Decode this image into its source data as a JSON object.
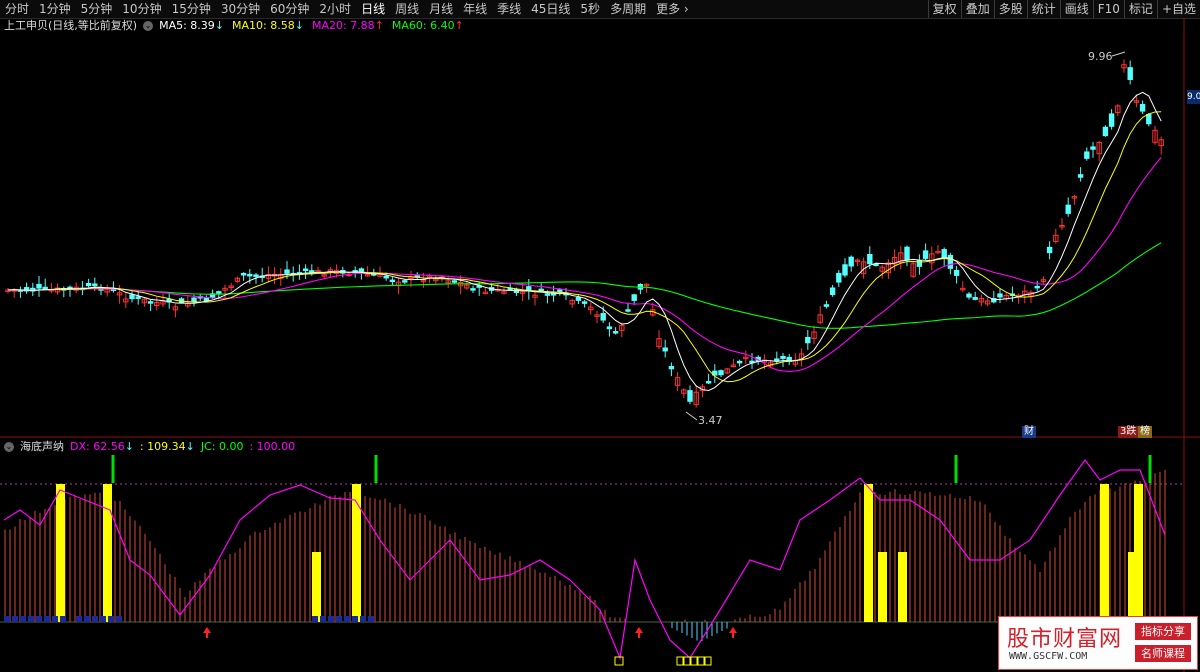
{
  "toolbar": {
    "periods": [
      "分时",
      "1分钟",
      "5分钟",
      "10分钟",
      "15分钟",
      "30分钟",
      "60分钟",
      "2小时",
      "日线",
      "周线",
      "月线",
      "年线",
      "季线",
      "45日线",
      "5秒",
      "多周期",
      "更多 ›"
    ],
    "active_period": "日线",
    "right_tools": [
      "复权",
      "叠加",
      "多股",
      "统计",
      "画线",
      "F10",
      "标记",
      "+自选"
    ]
  },
  "main_chart": {
    "stock_label": "上工申贝(日线,等比前复权)",
    "ma": [
      {
        "label": "MA5: 8.39",
        "arrow": "↓",
        "color": "#ffffff"
      },
      {
        "label": "MA10: 8.58",
        "arrow": "↓",
        "color": "#ffff00"
      },
      {
        "label": "MA20: 7.88",
        "arrow": "↑",
        "color": "#ff00ff"
      },
      {
        "label": "MA60: 6.40",
        "arrow": "↑",
        "color": "#00ff00"
      }
    ],
    "high_label": "9.96",
    "low_label": "3.47",
    "price_tag": "9.0",
    "badge_cai": "财",
    "badge_die": "3跌",
    "badge_bang": "榜"
  },
  "indicator": {
    "name": "海底声纳",
    "values": [
      {
        "label": "DX: 62.56",
        "arrow": "↓",
        "color": "#ff00ff"
      },
      {
        "label": ": 109.34",
        "arrow": "↓",
        "color": "#ffff00"
      },
      {
        "label": "JC: 0.00",
        "arrow": "",
        "color": "#00ff00"
      },
      {
        "label": ": 100.00",
        "arrow": "",
        "color": "#ff00ff"
      }
    ]
  },
  "watermark": {
    "title": "股市财富网",
    "url": "WWW.GSCFW.COM",
    "tag1": "指标分享",
    "tag2": "名师课程"
  },
  "colors": {
    "up": "#ff3232",
    "down": "#54ffff",
    "ma5": "#ffffff",
    "ma10": "#ffff00",
    "ma20": "#ff00ff",
    "ma60": "#00ff00"
  }
}
